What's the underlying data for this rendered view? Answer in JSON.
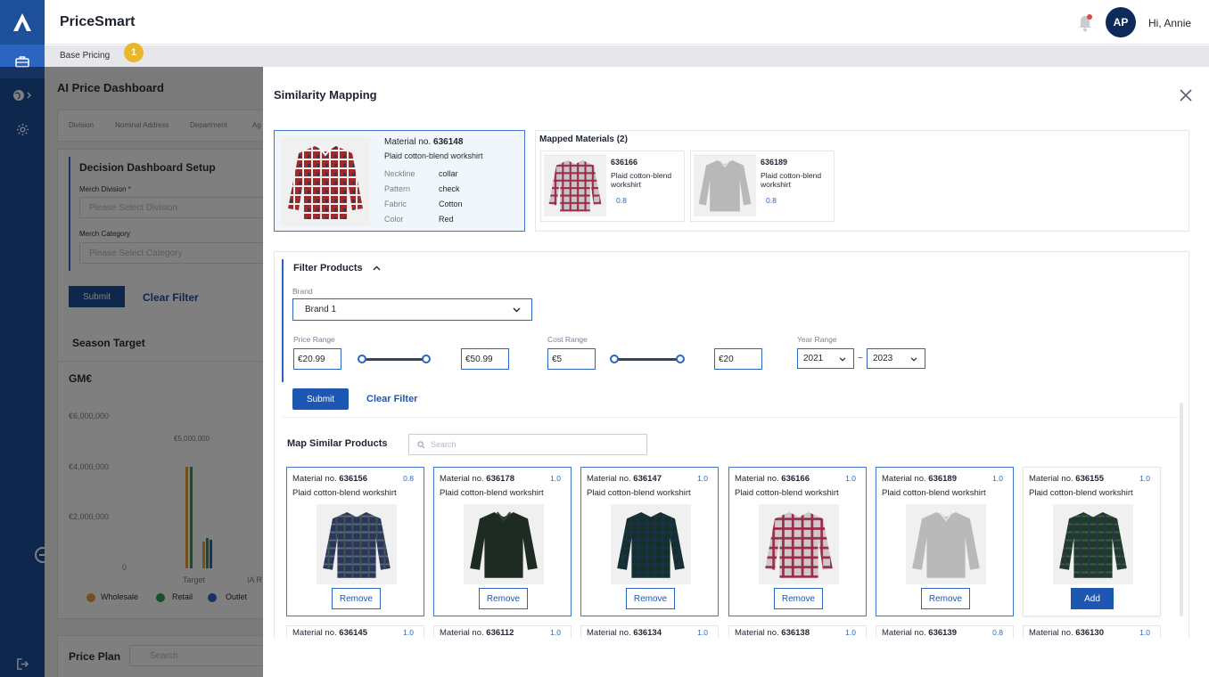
{
  "app": {
    "title": "PriceSmart",
    "user_initials": "AP",
    "greeting": "Hi, Annie"
  },
  "breadcrumb": {
    "label": "Base Pricing",
    "badge": "1"
  },
  "background": {
    "title": "AI Price Dashboard",
    "tabs": [
      "Division",
      "Nominal Address",
      "Department",
      "Ag"
    ],
    "setup_title": "Decision Dashboard Setup",
    "merch_division_label": "Merch Division *",
    "merch_division_placeholder": "Please Select Division",
    "merch_category_label": "Merch Category",
    "merch_category_placeholder": "Please Select Category",
    "submit": "Submit",
    "clear_filter": "Clear Filter",
    "season_title": "Season Target",
    "chart_title": "GM€",
    "y_ticks": [
      "€6,000,000",
      "€4,000,000",
      "€2,000,000",
      "0"
    ],
    "bar_label": "€5,000,000",
    "x_labels": [
      "Target",
      "IA R"
    ],
    "legend": [
      "Wholesale",
      "Retail",
      "Outlet"
    ],
    "legend_colors": [
      "#e8a13a",
      "#2e9e5b",
      "#2a65c2"
    ],
    "price_plan": "Price Plan",
    "price_plan_search": "Search"
  },
  "modal": {
    "title": "Similarity Mapping",
    "source": {
      "material_label": "Material no.",
      "material_no": "636148",
      "description": "Plaid cotton-blend workshirt",
      "attributes": [
        {
          "key": "Neckline",
          "value": "collar"
        },
        {
          "key": "Pattern",
          "value": "check"
        },
        {
          "key": "Fabric",
          "value": "Cotton"
        },
        {
          "key": "Color",
          "value": "Red"
        }
      ]
    },
    "mapped": {
      "title": "Mapped Materials (2)",
      "items": [
        {
          "material_no": "636166",
          "description": "Plaid cotton-blend workshirt",
          "score": "0.8",
          "shirt": "red"
        },
        {
          "material_no": "636189",
          "description": "Plaid cotton-blend workshirt",
          "score": "0.8",
          "shirt": "grey"
        }
      ]
    },
    "filter": {
      "title": "Filter Products",
      "brand_label": "Brand",
      "brand_value": "Brand 1",
      "price_label": "Price Range",
      "price_min": "€20.99",
      "price_max": "€50.99",
      "cost_label": "Cost Range",
      "cost_min": "€5",
      "cost_max": "€20",
      "year_label": "Year Range",
      "year_from": "2021",
      "year_to": "2023",
      "year_sep": "~",
      "submit": "Submit",
      "clear": "Clear Filter"
    },
    "map": {
      "title": "Map Similar Products",
      "search_placeholder": "Search",
      "material_label": "Material no.",
      "products": [
        {
          "material_no": "636156",
          "score": "0.8",
          "description": "Plaid cotton-blend workshirt",
          "action": "Remove",
          "selected": true,
          "shirt": "navy"
        },
        {
          "material_no": "636178",
          "score": "1.0",
          "description": "Plaid cotton-blend workshirt",
          "action": "Remove",
          "selected": true,
          "shirt": "darkgreen"
        },
        {
          "material_no": "636147",
          "score": "1.0",
          "description": "Plaid cotton-blend workshirt",
          "action": "Remove",
          "selected": true,
          "shirt": "blackwatch"
        },
        {
          "material_no": "636166",
          "score": "1.0",
          "description": "Plaid cotton-blend workshirt",
          "action": "Remove",
          "selected": true,
          "shirt": "red"
        },
        {
          "material_no": "636189",
          "score": "1.0",
          "description": "Plaid cotton-blend workshirt",
          "action": "Remove",
          "selected": true,
          "shirt": "grey"
        },
        {
          "material_no": "636155",
          "score": "1.0",
          "description": "Plaid cotton-blend workshirt",
          "action": "Add",
          "selected": false,
          "shirt": "green"
        }
      ],
      "next_row": [
        {
          "material_no": "636145",
          "score": "1.0"
        },
        {
          "material_no": "636112",
          "score": "1.0"
        },
        {
          "material_no": "636134",
          "score": "1.0"
        },
        {
          "material_no": "636138",
          "score": "1.0"
        },
        {
          "material_no": "636139",
          "score": "0.8"
        },
        {
          "material_no": "636130",
          "score": "1.0"
        }
      ]
    }
  },
  "icons": {
    "logo": "logo-icon",
    "nav": [
      "briefcase-icon",
      "globe-icon",
      "gear-icon"
    ],
    "logout": "logout-icon",
    "bell": "bell-icon",
    "close": "close-icon"
  }
}
